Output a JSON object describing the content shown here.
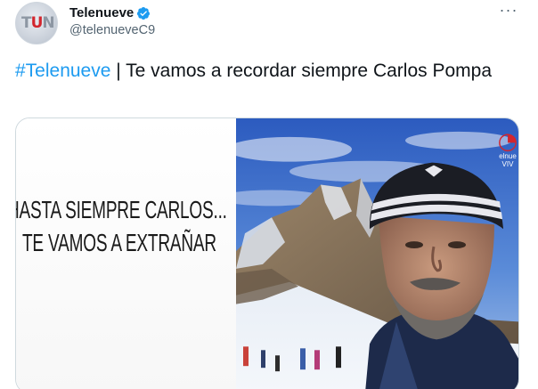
{
  "author": {
    "display_name": "Telenueve",
    "handle": "@telenueveC9",
    "avatar_text": "TN",
    "verified": true
  },
  "menu": {
    "more_label": "···"
  },
  "tweet": {
    "hashtag": "#Telenueve",
    "separator": " | ",
    "text": "Te vamos a recordar siempre Carlos Pompa"
  },
  "media": {
    "caption_line1": "HASTA SIEMPRE CARLOS...",
    "caption_line2": "TE VAMOS A EXTRAÑAR",
    "logo_text": "elnue",
    "logo_text2": "VIV"
  },
  "colors": {
    "accent": "#1d9bf0",
    "brand_red": "#d2262e",
    "text": "#0f1419",
    "secondary": "#536471"
  }
}
